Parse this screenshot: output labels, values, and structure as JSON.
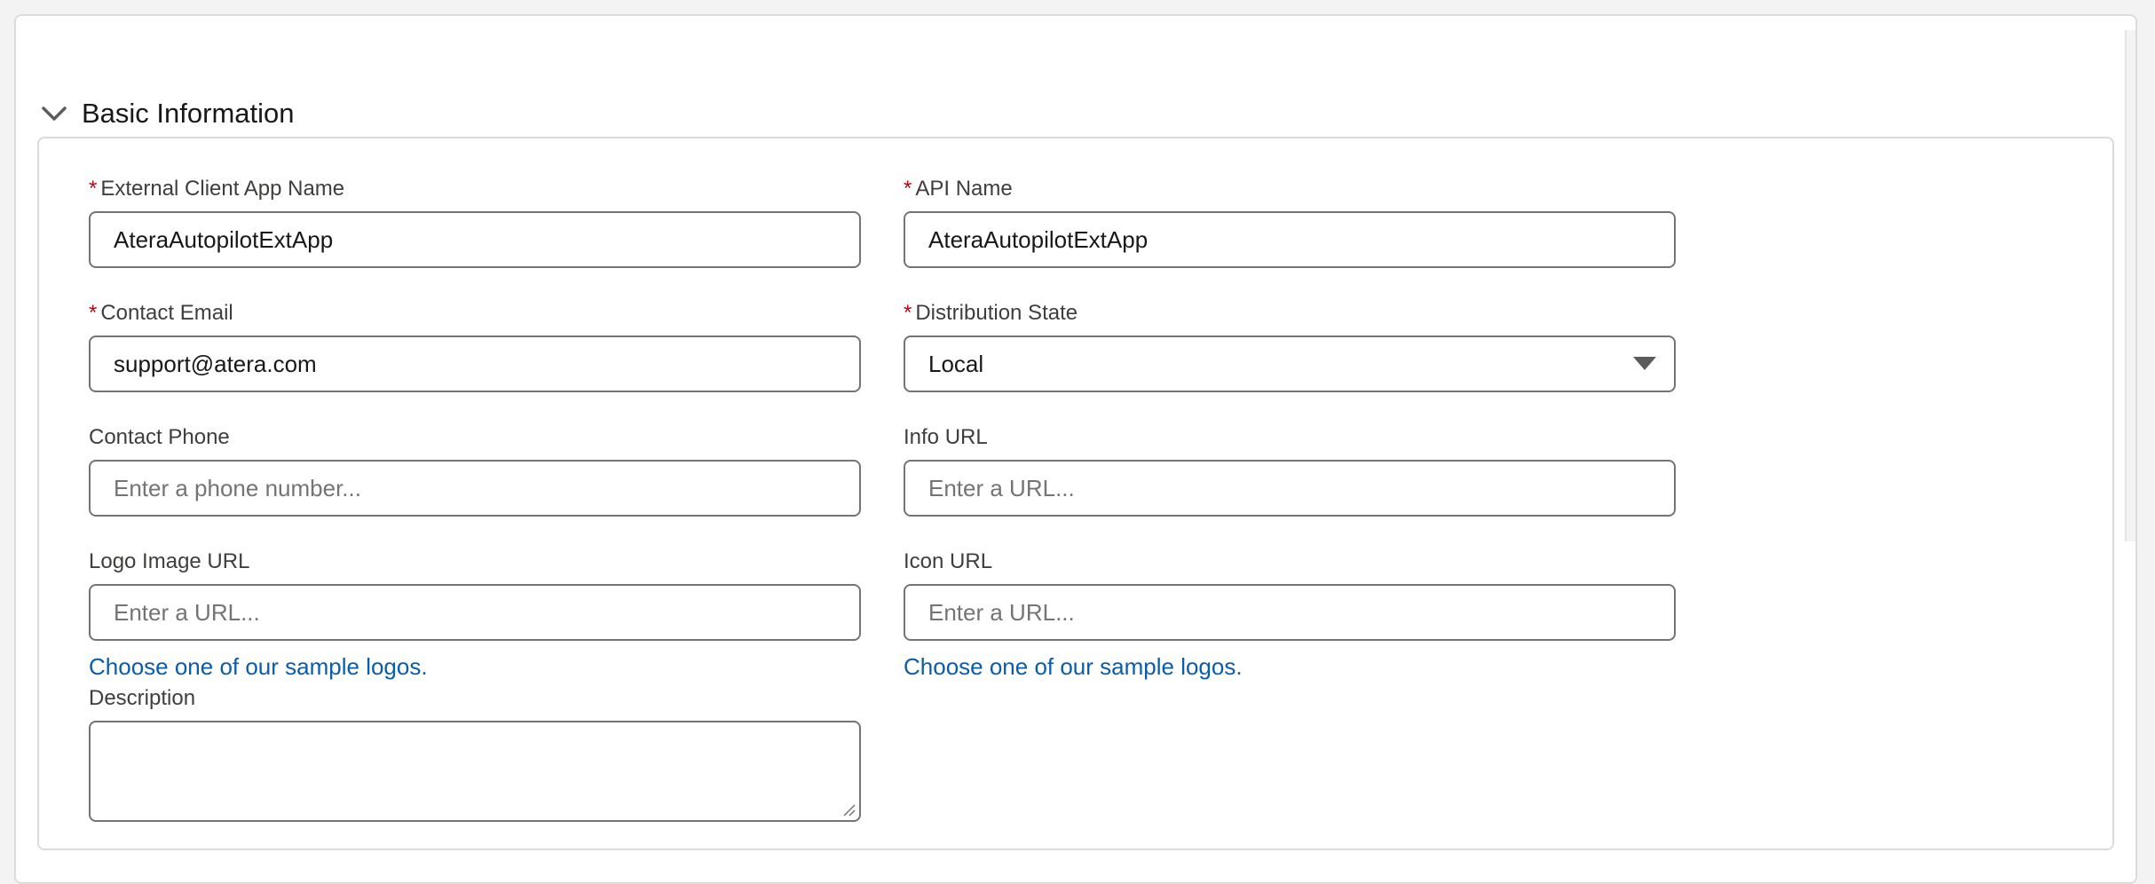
{
  "section": {
    "title": "Basic Information",
    "icon": "chevron-down-icon"
  },
  "fields": {
    "app_name": {
      "label": "External Client App Name",
      "required_mark": "*",
      "value": "AteraAutopilotExtApp"
    },
    "api_name": {
      "label": "API Name",
      "required_mark": "*",
      "value": "AteraAutopilotExtApp"
    },
    "contact_email": {
      "label": "Contact Email",
      "required_mark": "*",
      "value": "support@atera.com"
    },
    "distribution_state": {
      "label": "Distribution State",
      "required_mark": "*",
      "value": "Local"
    },
    "contact_phone": {
      "label": "Contact Phone",
      "placeholder": "Enter a phone number..."
    },
    "info_url": {
      "label": "Info URL",
      "placeholder": "Enter a URL..."
    },
    "logo_url": {
      "label": "Logo Image URL",
      "placeholder": "Enter a URL...",
      "link": "Choose one of our sample logos."
    },
    "icon_url": {
      "label": "Icon URL",
      "placeholder": "Enter a URL...",
      "link": "Choose one of our sample logos."
    },
    "description": {
      "label": "Description"
    }
  },
  "colors": {
    "required": "#ba0517",
    "link": "#0b5cab",
    "border": "#747474"
  }
}
